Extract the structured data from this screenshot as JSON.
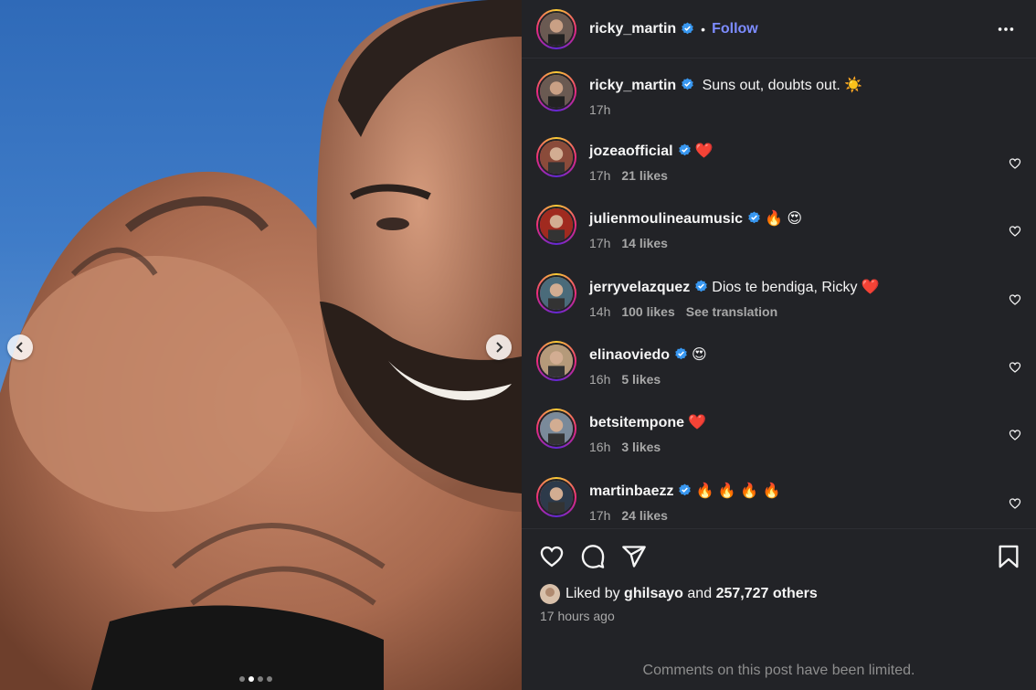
{
  "post": {
    "author": "ricky_martin",
    "follow_label": "Follow",
    "separator": "•",
    "caption": "Suns out, doubts out. ☀️",
    "caption_time": "17h"
  },
  "carousel": {
    "slide_count": 4,
    "active_slide": 2
  },
  "comments": [
    {
      "user": "jozeaofficial",
      "verified": true,
      "text": "❤️",
      "time": "17h",
      "likes": "21 likes",
      "translate": ""
    },
    {
      "user": "julienmoulineaumusic",
      "verified": true,
      "text": "🔥 😍",
      "time": "17h",
      "likes": "14 likes",
      "translate": ""
    },
    {
      "user": "jerryvelazquez",
      "verified": true,
      "text": "Dios te bendiga, Ricky ❤️",
      "time": "14h",
      "likes": "100 likes",
      "translate": "See translation"
    },
    {
      "user": "elinaoviedo",
      "verified": true,
      "text": "😍",
      "time": "16h",
      "likes": "5 likes",
      "translate": ""
    },
    {
      "user": "betsitempone",
      "verified": false,
      "text": "❤️",
      "time": "16h",
      "likes": "3 likes",
      "translate": ""
    },
    {
      "user": "martinbaezz",
      "verified": true,
      "text": "🔥 🔥 🔥 🔥",
      "time": "17h",
      "likes": "24 likes",
      "translate": ""
    }
  ],
  "likes_summary": {
    "prefix": "Liked by",
    "user": "ghilsayo",
    "and": "and",
    "others": "257,727 others"
  },
  "posted_ago": "17 hours ago",
  "comments_limited": "Comments on this post have been limited.",
  "colors": {
    "follow": "#7d8cff",
    "verified": "#3897f0",
    "panel": "#222327"
  }
}
